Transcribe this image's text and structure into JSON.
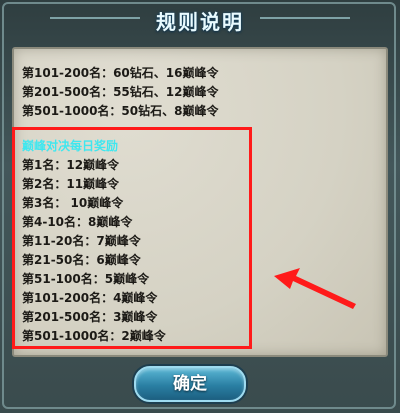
{
  "dialog": {
    "title": "规则说明",
    "confirm_label": "确定"
  },
  "rules": {
    "top_lines": [
      "第101-200名：60钻石、16巅峰令",
      "第201-500名：55钻石、12巅峰令",
      "第501-1000名：50钻石、8巅峰令"
    ],
    "daily_heading": "巅峰对决每日奖励",
    "daily_lines": [
      "第1名：12巅峰令",
      "第2名：11巅峰令",
      "第3名：  10巅峰令",
      "第4-10名：8巅峰令",
      "第11-20名：7巅峰令",
      "第21-50名：6巅峰令",
      "第51-100名：5巅峰令",
      "第101-200名：4巅峰令",
      "第201-500名：3巅峰令",
      "第501-1000名：2巅峰令"
    ]
  },
  "colors": {
    "highlight_box": "#ff1a1a",
    "arrow": "#ff1a1a",
    "section_heading": "#3fe7ef"
  }
}
